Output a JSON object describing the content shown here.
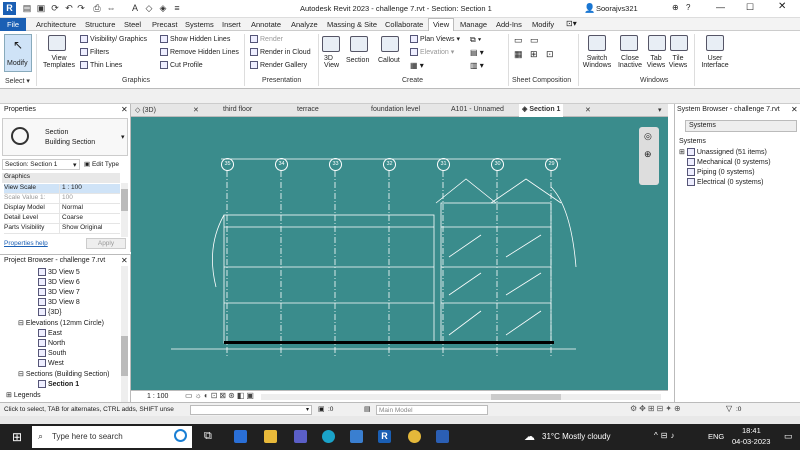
{
  "title": "Autodesk Revit 2023 - challenge 7.rvt - Section: Section 1",
  "user": "Soorajvs321",
  "ribbon_tabs": [
    "File",
    "Architecture",
    "Structure",
    "Steel",
    "Precast",
    "Systems",
    "Insert",
    "Annotate",
    "Analyze",
    "Massing & Site",
    "Collaborate",
    "View",
    "Manage",
    "Add-Ins",
    "Modify"
  ],
  "active_tab": "View",
  "ribbon": {
    "modify": "Modify",
    "select": "Select ▾",
    "view_templates": "View Templates",
    "visibility": "Visibility/ Graphics",
    "filters": "Filters",
    "thin_lines": "Thin Lines",
    "show_hidden": "Show Hidden Lines",
    "remove_hidden": "Remove Hidden Lines",
    "cut_profile": "Cut Profile",
    "graphics_label": "Graphics",
    "render": "Render",
    "render_cloud": "Render in Cloud",
    "render_gallery": "Render Gallery",
    "presentation_label": "Presentation",
    "view_3d": "3D View",
    "section": "Section",
    "callout": "Callout",
    "plan_views": "Plan Views",
    "elevation": "Elevation",
    "create_label": "Create",
    "sheet_label": "Sheet Composition",
    "switch_windows": "Switch Windows",
    "close_inactive": "Close Inactive",
    "tab_views": "Tab Views",
    "tile_views": "Tile Views",
    "user_interface": "User Interface",
    "windows_label": "Windows"
  },
  "view_tabs": [
    "(3D)",
    "third floor",
    "terrace",
    "foundation level",
    "A101 - Unnamed",
    "Section 1"
  ],
  "active_view_tab": "Section 1",
  "properties": {
    "title": "Properties",
    "type_name": "Section",
    "type_sub": "Building Section",
    "instance": "Section: Section 1",
    "edit_type": "Edit Type",
    "group": "Graphics",
    "rows": [
      {
        "k": "View Scale",
        "v": "1 : 100"
      },
      {
        "k": "Scale Value 1:",
        "v": "100"
      },
      {
        "k": "Display Model",
        "v": "Normal"
      },
      {
        "k": "Detail Level",
        "v": "Coarse"
      },
      {
        "k": "Parts Visibility",
        "v": "Show Original"
      }
    ],
    "help": "Properties help",
    "apply": "Apply"
  },
  "project_browser": {
    "title": "Project Browser - challenge 7.rvt",
    "items": [
      "3D View 5",
      "3D View 6",
      "3D View 7",
      "3D View 8",
      "{3D}"
    ],
    "elevations": "Elevations (12mm Circle)",
    "elev_items": [
      "East",
      "North",
      "South",
      "West"
    ],
    "sections": "Sections (Building Section)",
    "section_item": "Section 1",
    "legends": "Legends"
  },
  "system_browser": {
    "title": "System Browser - challenge 7.rvt",
    "dropdown": "Systems",
    "header": "Systems",
    "items": [
      "Unassigned (51 items)",
      "Mechanical (0 systems)",
      "Piping (0 systems)",
      "Electrical (0 systems)"
    ]
  },
  "grid_labels": [
    "35",
    "34",
    "33",
    "32",
    "31",
    "30",
    "29"
  ],
  "view_scale": "1 : 100",
  "status_text": "Click to select, TAB for alternates, CTRL adds, SHIFT unse",
  "zero": ":0",
  "main_model": "Main Model",
  "taskbar": {
    "search": "Type here to search",
    "weather": "31°C  Mostly cloudy",
    "lang": "ENG",
    "time": "18:41",
    "date": "04-03-2023"
  }
}
